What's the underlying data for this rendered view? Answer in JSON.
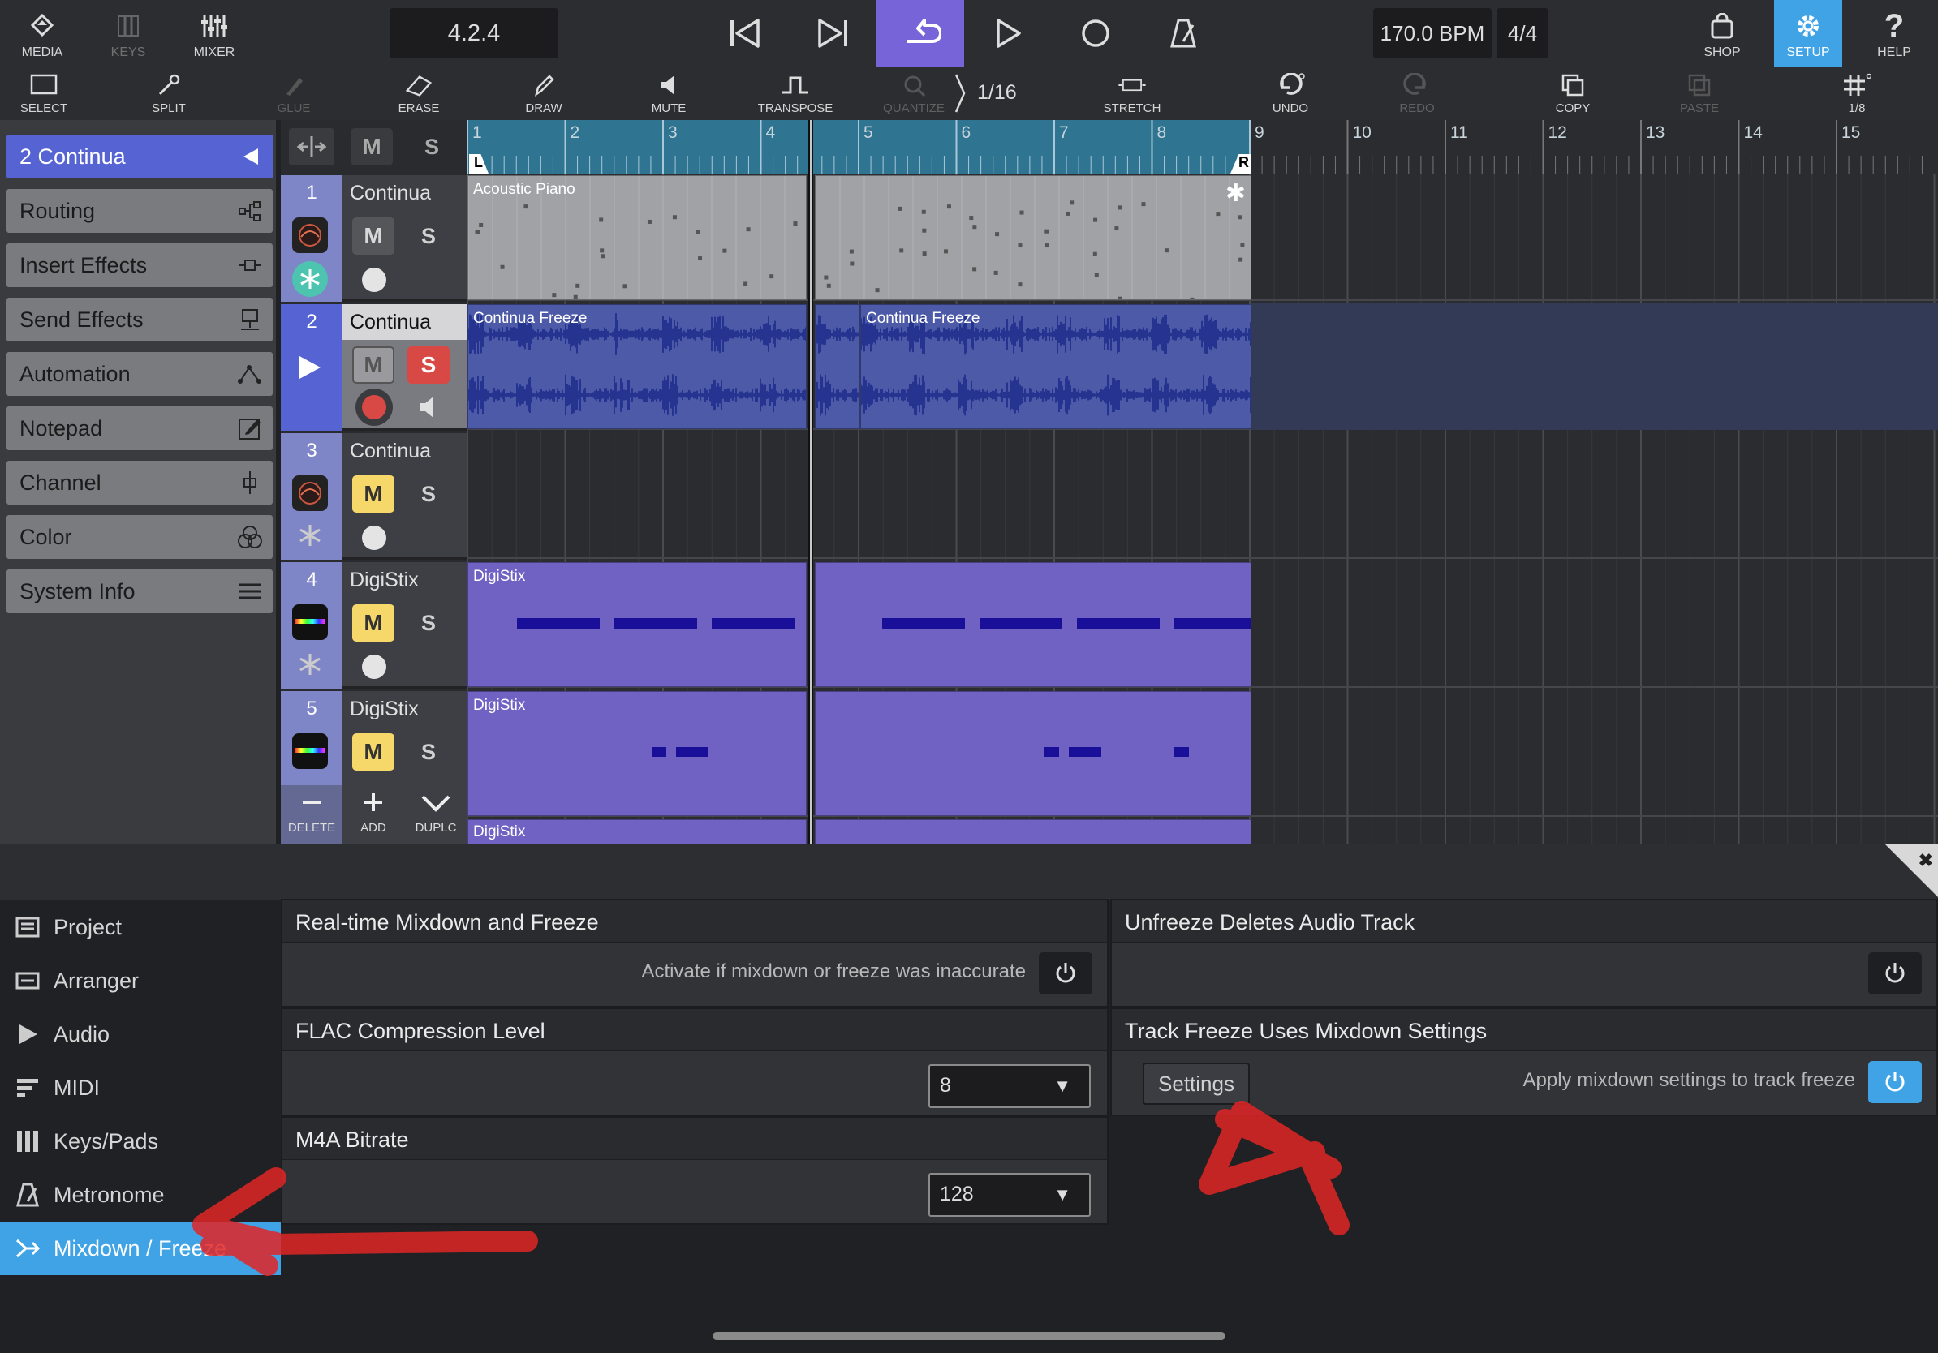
{
  "toolbar": {
    "media": "MEDIA",
    "keys": "KEYS",
    "mixer": "MIXER",
    "version": "4.2.4",
    "tempo": "170.0 BPM",
    "timesig": "4/4",
    "shop": "SHOP",
    "setup": "SETUP",
    "help": "HELP"
  },
  "tools": {
    "select": "SELECT",
    "split": "SPLIT",
    "glue": "GLUE",
    "erase": "ERASE",
    "draw": "DRAW",
    "mute": "MUTE",
    "transpose": "TRANSPOSE",
    "quantize": "QUANTIZE",
    "quantize_value": "1/16",
    "stretch": "STRETCH",
    "undo": "UNDO",
    "redo": "REDO",
    "copy": "COPY",
    "paste": "PASTE",
    "grid": "1/8"
  },
  "inspector": {
    "selected": "2  Continua",
    "items": [
      "Routing",
      "Insert Effects",
      "Send Effects",
      "Automation",
      "Notepad",
      "Channel",
      "Color",
      "System Info"
    ]
  },
  "tracks": [
    {
      "num": "1",
      "name": "Continua",
      "m": "M",
      "s": "S"
    },
    {
      "num": "2",
      "name": "Continua",
      "m": "M",
      "s": "S"
    },
    {
      "num": "3",
      "name": "Continua",
      "m": "M",
      "s": "S"
    },
    {
      "num": "4",
      "name": "DigiStix",
      "m": "M",
      "s": "S"
    },
    {
      "num": "5",
      "name": "DigiStix",
      "m": "M",
      "s": "S"
    }
  ],
  "track_header": {
    "m": "M",
    "s": "S"
  },
  "track_actions": {
    "delete": "DELETE",
    "add": "ADD",
    "duplicate": "DUPLC"
  },
  "ruler": {
    "bars": [
      "1",
      "2",
      "3",
      "4",
      "5",
      "6",
      "7",
      "8",
      "9",
      "10",
      "11",
      "12",
      "13",
      "14",
      "15"
    ],
    "loop_left": "L",
    "loop_right": "R"
  },
  "clips": {
    "acoustic": "Acoustic Piano",
    "freeze": "Continua Freeze",
    "digi": "DigiStix"
  },
  "settings_nav": [
    "Project",
    "Arranger",
    "Audio",
    "MIDI",
    "Keys/Pads",
    "Metronome",
    "Mixdown / Freeze"
  ],
  "settings": {
    "realtime_title": "Real-time Mixdown and Freeze",
    "realtime_desc": "Activate if mixdown or freeze was inaccurate",
    "unfreeze_title": "Unfreeze Deletes Audio Track",
    "flac_title": "FLAC Compression Level",
    "flac_value": "8",
    "trackfreeze_title": "Track Freeze Uses Mixdown Settings",
    "settings_button": "Settings",
    "trackfreeze_desc": "Apply mixdown settings to track freeze",
    "m4a_title": "M4A Bitrate",
    "m4a_value": "128"
  },
  "colors": {
    "accent": "#3fa3e6",
    "selected_track": "#5564d2",
    "annotation": "#e02424"
  }
}
